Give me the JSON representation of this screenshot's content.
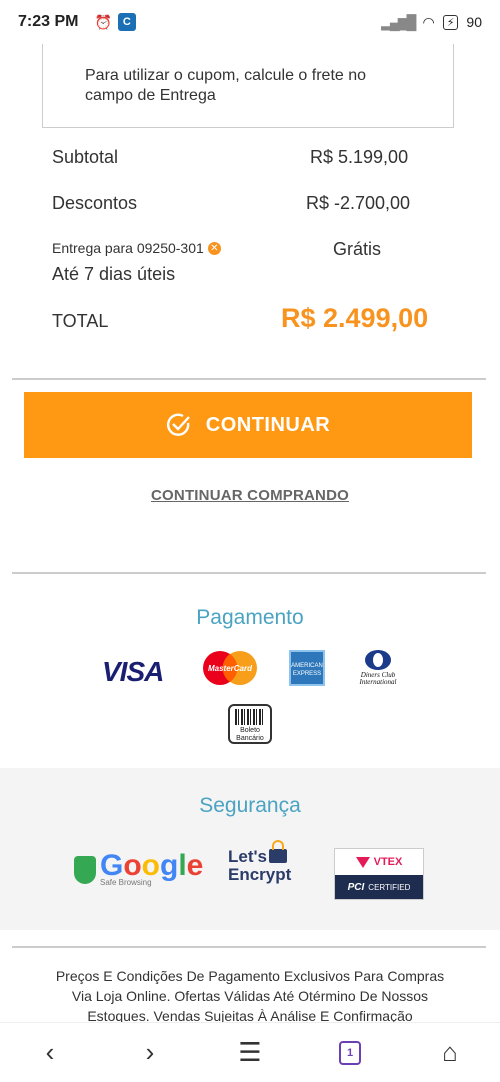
{
  "status_bar": {
    "time": "7:23 PM",
    "battery": "90"
  },
  "coupon": {
    "message": "Para utilizar o cupom, calcule o frete no campo de Entrega"
  },
  "summary": {
    "subtotal_label": "Subtotal",
    "subtotal_value": "R$ 5.199,00",
    "discounts_label": "Descontos",
    "discounts_value": "R$ -2.700,00",
    "delivery_label": "Entrega para 09250-301",
    "delivery_value": "Grátis",
    "delivery_time": "Até 7 dias úteis",
    "total_label": "TOTAL",
    "total_value": "R$ 2.499,00"
  },
  "actions": {
    "continue_label": "CONTINUAR",
    "continue_shopping_label": "CONTINUAR COMPRANDO"
  },
  "payment": {
    "title": "Pagamento",
    "methods": {
      "visa": "VISA",
      "mastercard": "MasterCard",
      "amex": "AMERICAN EXPRESS",
      "diners": "Diners Club International",
      "boleto": "Boleto Bancário"
    }
  },
  "security": {
    "title": "Segurança",
    "google": "Google",
    "google_sub": "Safe Browsing",
    "letsencrypt_1": "Let's",
    "letsencrypt_2": "Encrypt",
    "vtex": "VTEX",
    "pci": "PCI",
    "pci_certified": "CERTIFIED"
  },
  "footer": {
    "text": "Preços E Condições De Pagamento Exclusivos Para Compras Via Loja Online. Ofertas Válidas Até Otérmino De Nossos Estoques. Vendas Sujeitas À Análise E Confirmação"
  },
  "browser_nav": {
    "tab_count": "1"
  },
  "colors": {
    "accent": "#ff9914",
    "total": "#f7931e",
    "section_title": "#4aa3c2"
  }
}
